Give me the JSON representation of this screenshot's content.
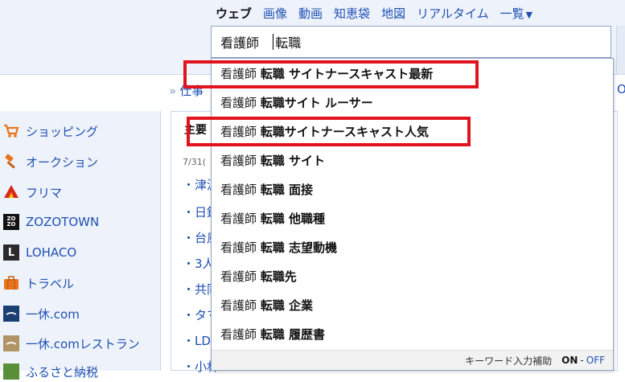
{
  "nav": {
    "items": [
      {
        "label": "ウェブ",
        "active": true
      },
      {
        "label": "画像",
        "active": false
      },
      {
        "label": "動画",
        "active": false
      },
      {
        "label": "知恵袋",
        "active": false
      },
      {
        "label": "地図",
        "active": false
      },
      {
        "label": "リアルタイム",
        "active": false
      },
      {
        "label": "一覧",
        "active": false
      }
    ],
    "more_caret": "▼"
  },
  "search": {
    "query_part1": "看護師",
    "query_part2": "転職"
  },
  "crumb": {
    "arrow": "»",
    "text": "仕事",
    "right_text": "Or"
  },
  "sidebar": {
    "items": [
      {
        "label": "ショッピング",
        "icon": "cart-icon"
      },
      {
        "label": "オークション",
        "icon": "gavel-icon"
      },
      {
        "label": "フリマ",
        "icon": "tent-icon"
      },
      {
        "label": "ZOZOTOWN",
        "icon": "zozo-icon",
        "icon_text": "ZO ZO"
      },
      {
        "label": "LOHACO",
        "icon": "lohaco-icon",
        "icon_text": "L"
      },
      {
        "label": "トラベル",
        "icon": "suitcase-icon"
      },
      {
        "label": "一休.com",
        "icon": "ikyu-icon"
      },
      {
        "label": "一休.comレストラン",
        "icon": "ikyu-restaurant-icon"
      },
      {
        "label": "ふるさと納税",
        "icon": "furusato-icon"
      }
    ]
  },
  "news": {
    "heading": "主要",
    "date": "7/31(",
    "items": [
      "・津波",
      "・日銀",
      "・台風",
      "・3人",
      "・共同",
      "・タマ",
      "・LDI",
      "・小林"
    ]
  },
  "suggest": {
    "rows": [
      {
        "base": "看護師 ",
        "rest": "転職 サイトナースキャスト最新"
      },
      {
        "base": "看護師 ",
        "rest": "転職サイト ルーサー"
      },
      {
        "base": "看護師 ",
        "rest": "転職サイトナースキャスト人気"
      },
      {
        "base": "看護師 ",
        "rest": "転職 サイト"
      },
      {
        "base": "看護師 ",
        "rest": "転職 面接"
      },
      {
        "base": "看護師 ",
        "rest": "転職 他職種"
      },
      {
        "base": "看護師 ",
        "rest": "転職 志望動機"
      },
      {
        "base": "看護師 ",
        "rest": "転職先"
      },
      {
        "base": "看護師 ",
        "rest": "転職 企業"
      },
      {
        "base": "看護師 ",
        "rest": "転職 履歴書"
      }
    ],
    "footer": {
      "label": "キーワード入力補助",
      "on": "ON",
      "sep": "-",
      "off": "OFF"
    }
  },
  "colors": {
    "highlight": "#e1141e",
    "link": "#1f4fb3",
    "header_bg": "#eef3fb"
  }
}
